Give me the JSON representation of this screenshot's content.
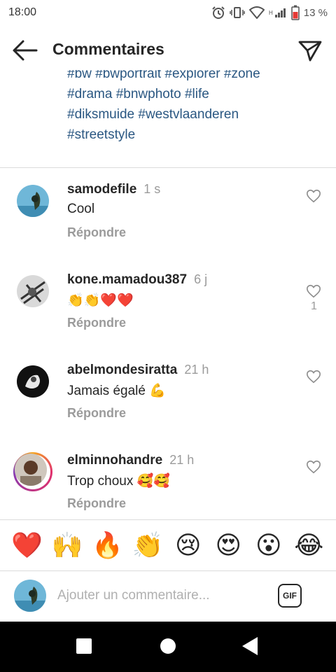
{
  "status_bar": {
    "time": "18:00",
    "network": "H",
    "battery": "13 %",
    "icons": [
      "alarm-icon",
      "vibrate-icon",
      "wifi-icon",
      "signal-icon",
      "battery-icon"
    ]
  },
  "header": {
    "title": "Commentaires",
    "back_icon": "arrow-left-icon",
    "share_icon": "paper-plane-icon"
  },
  "caption": {
    "lines": [
      "#bw #bwportrait #explorer #zone",
      "#drama #bnwphoto #life",
      "#diksmuide #westvlaanderen",
      "#streetstyle"
    ]
  },
  "comments": [
    {
      "username": "samodefile",
      "time": "1 s",
      "text": "Cool",
      "reply_label": "Répondre",
      "likes": ""
    },
    {
      "username": "kone.mamadou387",
      "time": "6 j",
      "text": "👏👏❤️❤️",
      "reply_label": "Répondre",
      "likes": "1"
    },
    {
      "username": "abelmondesiratta",
      "time": "21 h",
      "text": "Jamais égalé 💪",
      "reply_label": "Répondre",
      "likes": ""
    },
    {
      "username": "elminnohandre",
      "time": "21 h",
      "text": "Trop choux 🥰🥰",
      "reply_label": "Répondre",
      "likes": ""
    }
  ],
  "reactions": [
    "❤️",
    "🙌",
    "🔥",
    "👏",
    "😢",
    "😍",
    "😮",
    "😂"
  ],
  "composer": {
    "placeholder": "Ajouter un commentaire...",
    "gif_label": "GIF"
  },
  "navbar": {
    "icons": [
      "recents-square-icon",
      "home-circle-icon",
      "back-triangle-icon"
    ]
  },
  "colors": {
    "hashtag": "#2a5782",
    "muted": "#9b9b9b",
    "text": "#262626"
  }
}
